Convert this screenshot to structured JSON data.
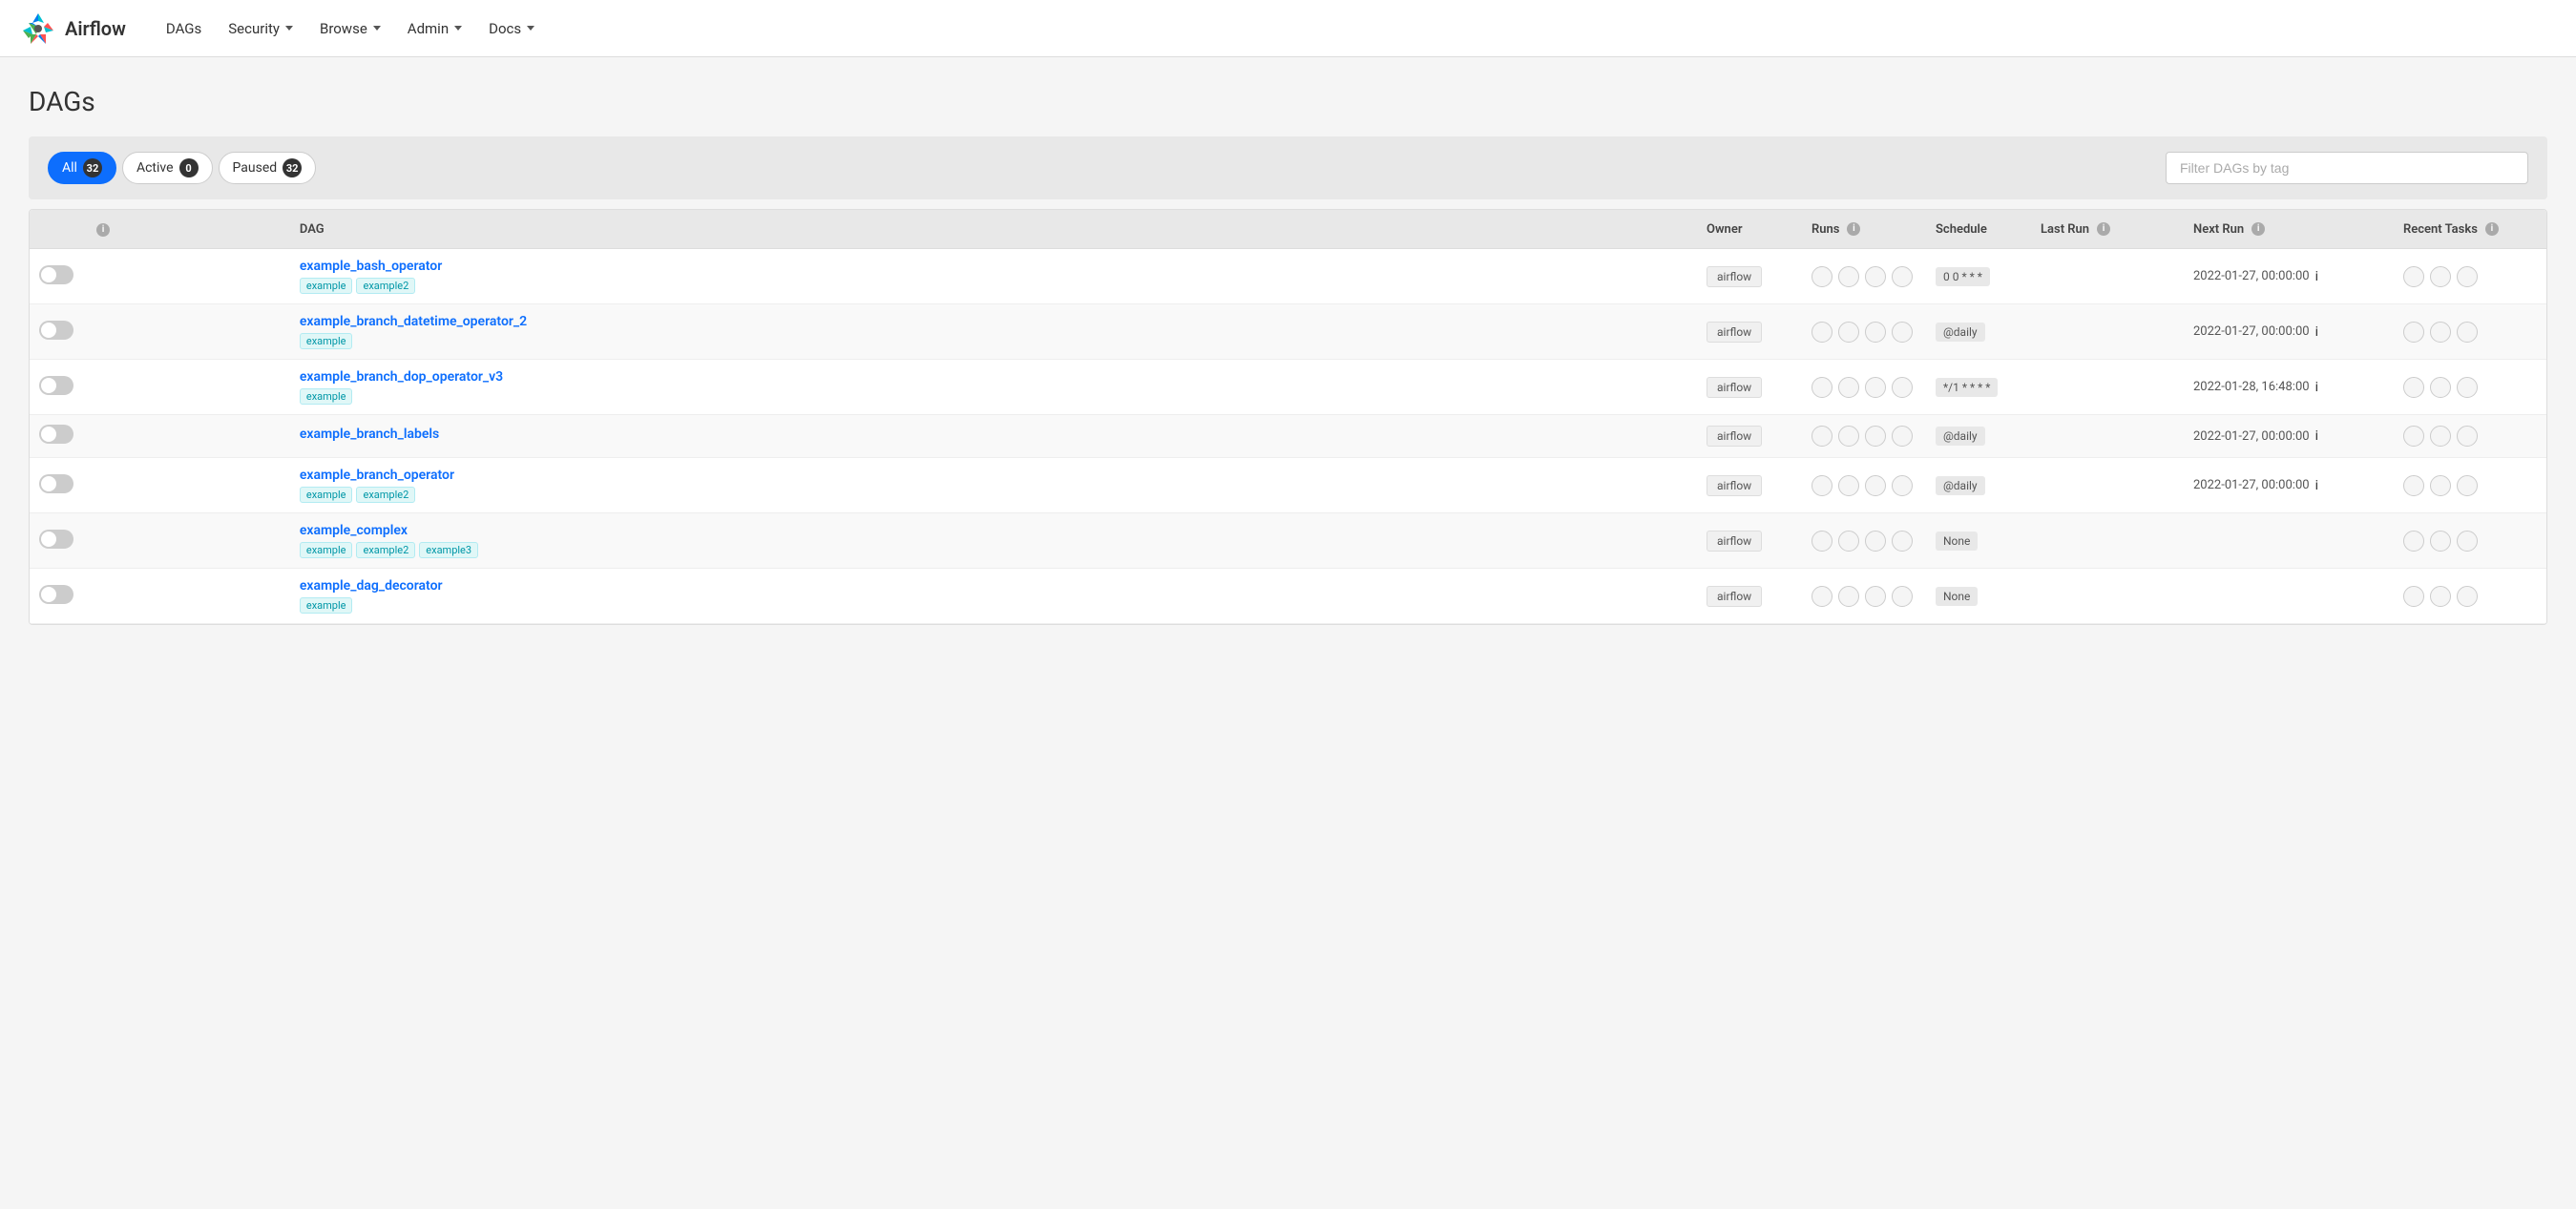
{
  "navbar": {
    "brand": "Airflow",
    "items": [
      {
        "label": "DAGs",
        "hasDropdown": false
      },
      {
        "label": "Security",
        "hasDropdown": true
      },
      {
        "label": "Browse",
        "hasDropdown": true
      },
      {
        "label": "Admin",
        "hasDropdown": true
      },
      {
        "label": "Docs",
        "hasDropdown": true
      }
    ]
  },
  "page": {
    "title": "DAGs"
  },
  "filters": {
    "tabs": [
      {
        "label": "All",
        "count": "32",
        "active": true
      },
      {
        "label": "Active",
        "count": "0",
        "active": false
      },
      {
        "label": "Paused",
        "count": "32",
        "active": false
      }
    ],
    "search_placeholder": "Filter DAGs by tag"
  },
  "table": {
    "columns": [
      {
        "key": "toggle",
        "label": ""
      },
      {
        "key": "info",
        "label": ""
      },
      {
        "key": "dag",
        "label": "DAG"
      },
      {
        "key": "owner",
        "label": "Owner"
      },
      {
        "key": "runs",
        "label": "Runs"
      },
      {
        "key": "schedule",
        "label": "Schedule"
      },
      {
        "key": "lastrun",
        "label": "Last Run"
      },
      {
        "key": "nextrun",
        "label": "Next Run"
      },
      {
        "key": "recenttasks",
        "label": "Recent Tasks"
      }
    ],
    "rows": [
      {
        "id": "example_bash_operator",
        "name": "example_bash_operator",
        "tags": [
          "example",
          "example2"
        ],
        "owner": "airflow",
        "runs": [
          false,
          false,
          false,
          false
        ],
        "schedule": "0 0 * * *",
        "lastrun": "",
        "nextrun": "2022-01-27, 00:00:00",
        "paused": true
      },
      {
        "id": "example_branch_datetime_operator_2",
        "name": "example_branch_datetime_operator_2",
        "tags": [
          "example"
        ],
        "owner": "airflow",
        "runs": [
          false,
          false,
          false,
          false
        ],
        "schedule": "@daily",
        "lastrun": "",
        "nextrun": "2022-01-27, 00:00:00",
        "paused": true
      },
      {
        "id": "example_branch_dop_operator_v3",
        "name": "example_branch_dop_operator_v3",
        "tags": [
          "example"
        ],
        "owner": "airflow",
        "runs": [
          false,
          false,
          false,
          false
        ],
        "schedule": "*/1 * * * *",
        "lastrun": "",
        "nextrun": "2022-01-28, 16:48:00",
        "paused": true
      },
      {
        "id": "example_branch_labels",
        "name": "example_branch_labels",
        "tags": [],
        "owner": "airflow",
        "runs": [
          false,
          false,
          false,
          false
        ],
        "schedule": "@daily",
        "lastrun": "",
        "nextrun": "2022-01-27, 00:00:00",
        "paused": true
      },
      {
        "id": "example_branch_operator",
        "name": "example_branch_operator",
        "tags": [
          "example",
          "example2"
        ],
        "owner": "airflow",
        "runs": [
          false,
          false,
          false,
          false
        ],
        "schedule": "@daily",
        "lastrun": "",
        "nextrun": "2022-01-27, 00:00:00",
        "paused": true
      },
      {
        "id": "example_complex",
        "name": "example_complex",
        "tags": [
          "example",
          "example2",
          "example3"
        ],
        "owner": "airflow",
        "runs": [
          false,
          false,
          false,
          false
        ],
        "schedule": "None",
        "lastrun": "",
        "nextrun": "",
        "paused": true
      },
      {
        "id": "example_dag_decorator",
        "name": "example_dag_decorator",
        "tags": [
          "example"
        ],
        "owner": "airflow",
        "runs": [
          false,
          false,
          false,
          false
        ],
        "schedule": "None",
        "lastrun": "",
        "nextrun": "",
        "paused": true
      }
    ]
  }
}
